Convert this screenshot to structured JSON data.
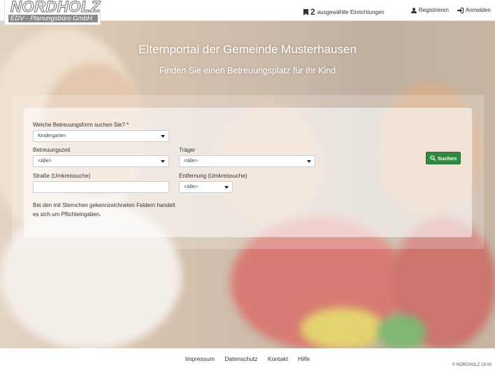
{
  "header": {
    "logo_main": "NORDHOLZ",
    "logo_sub": "EDV - Planungsbüro GmbH",
    "selected_count": "2",
    "selected_label": "ausgewählte Einrichtungen",
    "register_label": "Registrieren",
    "login_label": "Anmelden"
  },
  "hero": {
    "title": "Elternportal der Gemeinde Musterhausen",
    "subtitle": "Finden Sie einen Betreuungsplatz für Ihr Kind"
  },
  "form": {
    "care_type_label": "Welche Betreuungsform suchen Sie? *",
    "care_type_value": "Kindergarten",
    "care_time_label": "Betreuungszeit",
    "care_time_value": "<Alle>",
    "provider_label": "Träger",
    "provider_value": "<Alle>",
    "street_label": "Straße (Umkreissuche)",
    "street_value": "",
    "distance_label": "Entfernung (Umkreissuche)",
    "distance_value": "<Alle>",
    "hint_text": "Bei den mit Sternchen gekennzeichneten Feldern handelt es sich um Pflichteingaben.",
    "search_button": "Suchen"
  },
  "footer": {
    "links": [
      "Impressum",
      "Datenschutz",
      "Kontakt",
      "Hilfe"
    ],
    "copyright": "© NORDHOLZ 19.00"
  },
  "colors": {
    "accent_green": "#2e8b3f",
    "header_bg": "#ffffff"
  },
  "icons": {
    "bookmark": "bookmark-icon",
    "user": "user-icon",
    "login": "sign-in-icon",
    "search": "search-icon"
  }
}
